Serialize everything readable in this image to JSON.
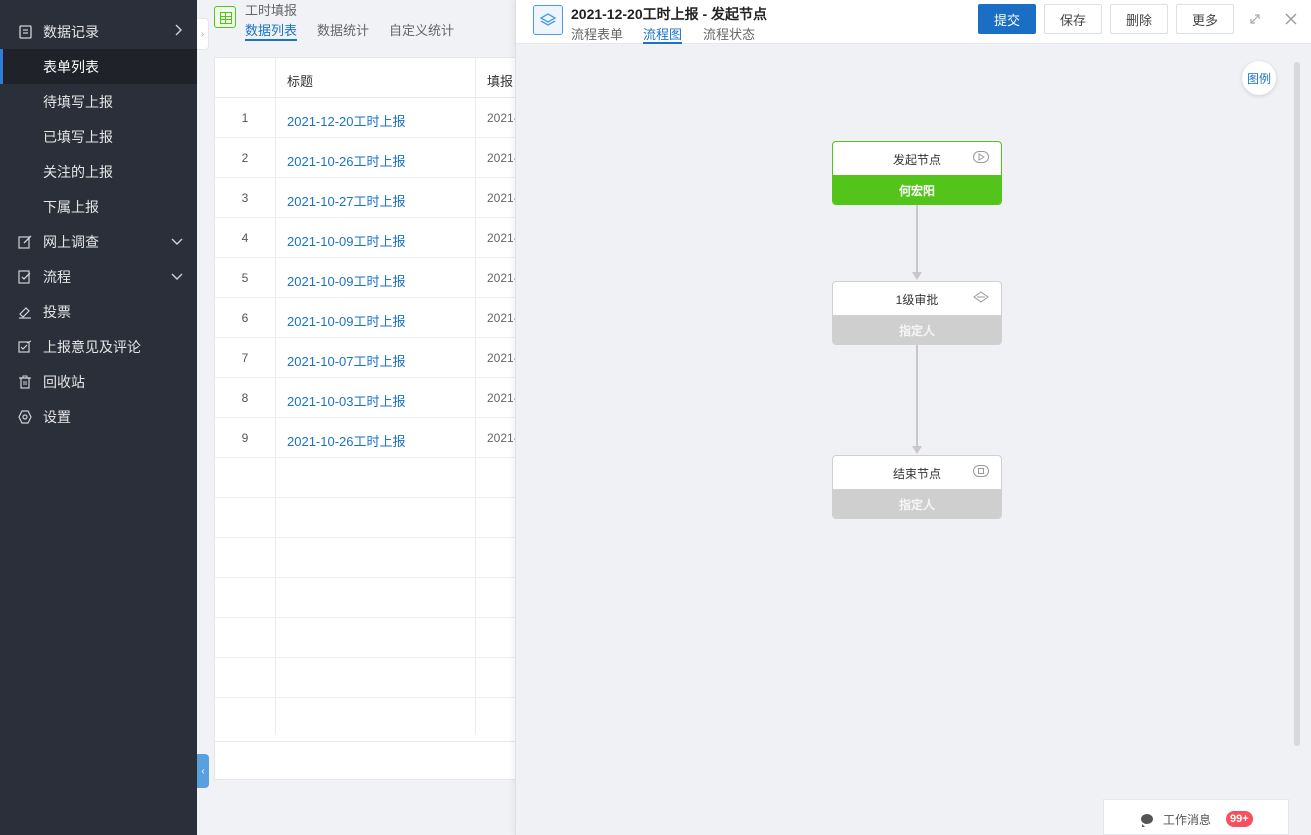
{
  "sidebar": {
    "items": [
      {
        "label": "数据记录",
        "icon": "document-icon",
        "chevron": "›"
      },
      {
        "label": "表单列表"
      },
      {
        "label": "待填写上报"
      },
      {
        "label": "已填写上报"
      },
      {
        "label": "关注的上报"
      },
      {
        "label": "下属上报"
      },
      {
        "label": "网上调查",
        "icon": "edit-icon",
        "chevron": "⌄"
      },
      {
        "label": "流程",
        "icon": "flow-icon",
        "chevron": "⌄"
      },
      {
        "label": "投票",
        "icon": "vote-icon"
      },
      {
        "label": "上报意见及评论",
        "icon": "comment-edit-icon"
      },
      {
        "label": "回收站",
        "icon": "trash-icon"
      },
      {
        "label": "设置",
        "icon": "settings-icon"
      }
    ]
  },
  "app": {
    "title": "工时填报",
    "tabs": [
      "数据列表",
      "数据统计",
      "自定义统计"
    ]
  },
  "table": {
    "headers": [
      "标题",
      "填报日"
    ],
    "rows": [
      {
        "index": "1",
        "title": "2021-12-20工时上报",
        "date": "2021-"
      },
      {
        "index": "2",
        "title": "2021-10-26工时上报",
        "date": "2021-"
      },
      {
        "index": "3",
        "title": "2021-10-27工时上报",
        "date": "2021-"
      },
      {
        "index": "4",
        "title": "2021-10-09工时上报",
        "date": "2021-"
      },
      {
        "index": "5",
        "title": "2021-10-09工时上报",
        "date": "2021-"
      },
      {
        "index": "6",
        "title": "2021-10-09工时上报",
        "date": "2021-"
      },
      {
        "index": "7",
        "title": "2021-10-07工时上报",
        "date": "2021-"
      },
      {
        "index": "8",
        "title": "2021-10-03工时上报",
        "date": "2021-"
      },
      {
        "index": "9",
        "title": "2021-10-26工时上报",
        "date": "2021-"
      }
    ]
  },
  "drawer": {
    "title": "2021-12-20工时上报 - 发起节点",
    "tabs": [
      "流程表单",
      "流程图",
      "流程状态"
    ],
    "buttons": {
      "submit": "提交",
      "save": "保存",
      "delete": "删除",
      "more": "更多"
    },
    "legend": "图例"
  },
  "flow": {
    "nodes": [
      {
        "name": "发起节点",
        "assignee": "何宏阳",
        "state": "active"
      },
      {
        "name": "1级审批",
        "assignee": "指定人",
        "state": "pending"
      },
      {
        "name": "结束节点",
        "assignee": "指定人",
        "state": "pending"
      }
    ]
  },
  "messages": {
    "label": "工作消息",
    "badge": "99+"
  },
  "colors": {
    "accent": "#1a6fc4",
    "active_node": "#52c41a",
    "sidebar": "#2b2f3a",
    "badge": "#f5505d"
  }
}
